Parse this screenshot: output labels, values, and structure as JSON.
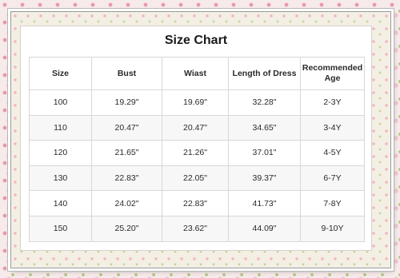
{
  "title": "Size Chart",
  "columns": [
    "Size",
    "Bust",
    "Wiast",
    "Length of Dress",
    "Recommended Age"
  ],
  "rows": [
    [
      "100",
      "19.29\"",
      "19.69\"",
      "32.28\"",
      "2-3Y"
    ],
    [
      "110",
      "20.47\"",
      "20.47\"",
      "34.65\"",
      "3-4Y"
    ],
    [
      "120",
      "21.65\"",
      "21.26\"",
      "37.01\"",
      "4-5Y"
    ],
    [
      "130",
      "22.83\"",
      "22.05\"",
      "39.37\"",
      "6-7Y"
    ],
    [
      "140",
      "24.02\"",
      "22.83\"",
      "41.73\"",
      "7-8Y"
    ],
    [
      "150",
      "25.20\"",
      "23.62\"",
      "44.09\"",
      "9-10Y"
    ]
  ]
}
